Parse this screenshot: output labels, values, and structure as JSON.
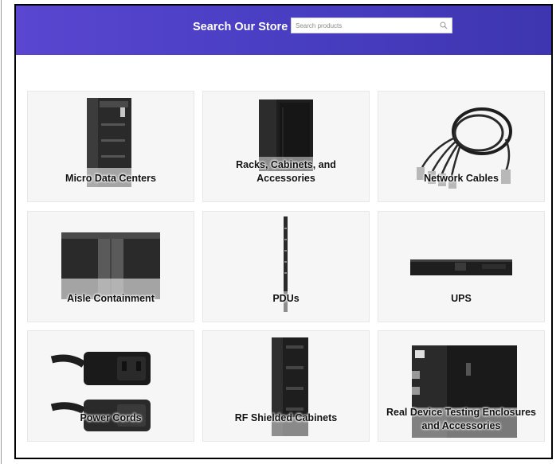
{
  "header": {
    "title": "Search Our Store",
    "search_placeholder": "Search products",
    "background": "#4a3fc4"
  },
  "categories": [
    {
      "label": "Micro Data Centers"
    },
    {
      "label": "Racks, Cabinets, and Accessories"
    },
    {
      "label": "Network Cables"
    },
    {
      "label": "Aisle Containment"
    },
    {
      "label": "PDUs"
    },
    {
      "label": "UPS"
    },
    {
      "label": "Power Cords"
    },
    {
      "label": "RF Shielded Cabinets"
    },
    {
      "label": "Real Device Testing Enclosures and Accessories"
    }
  ]
}
